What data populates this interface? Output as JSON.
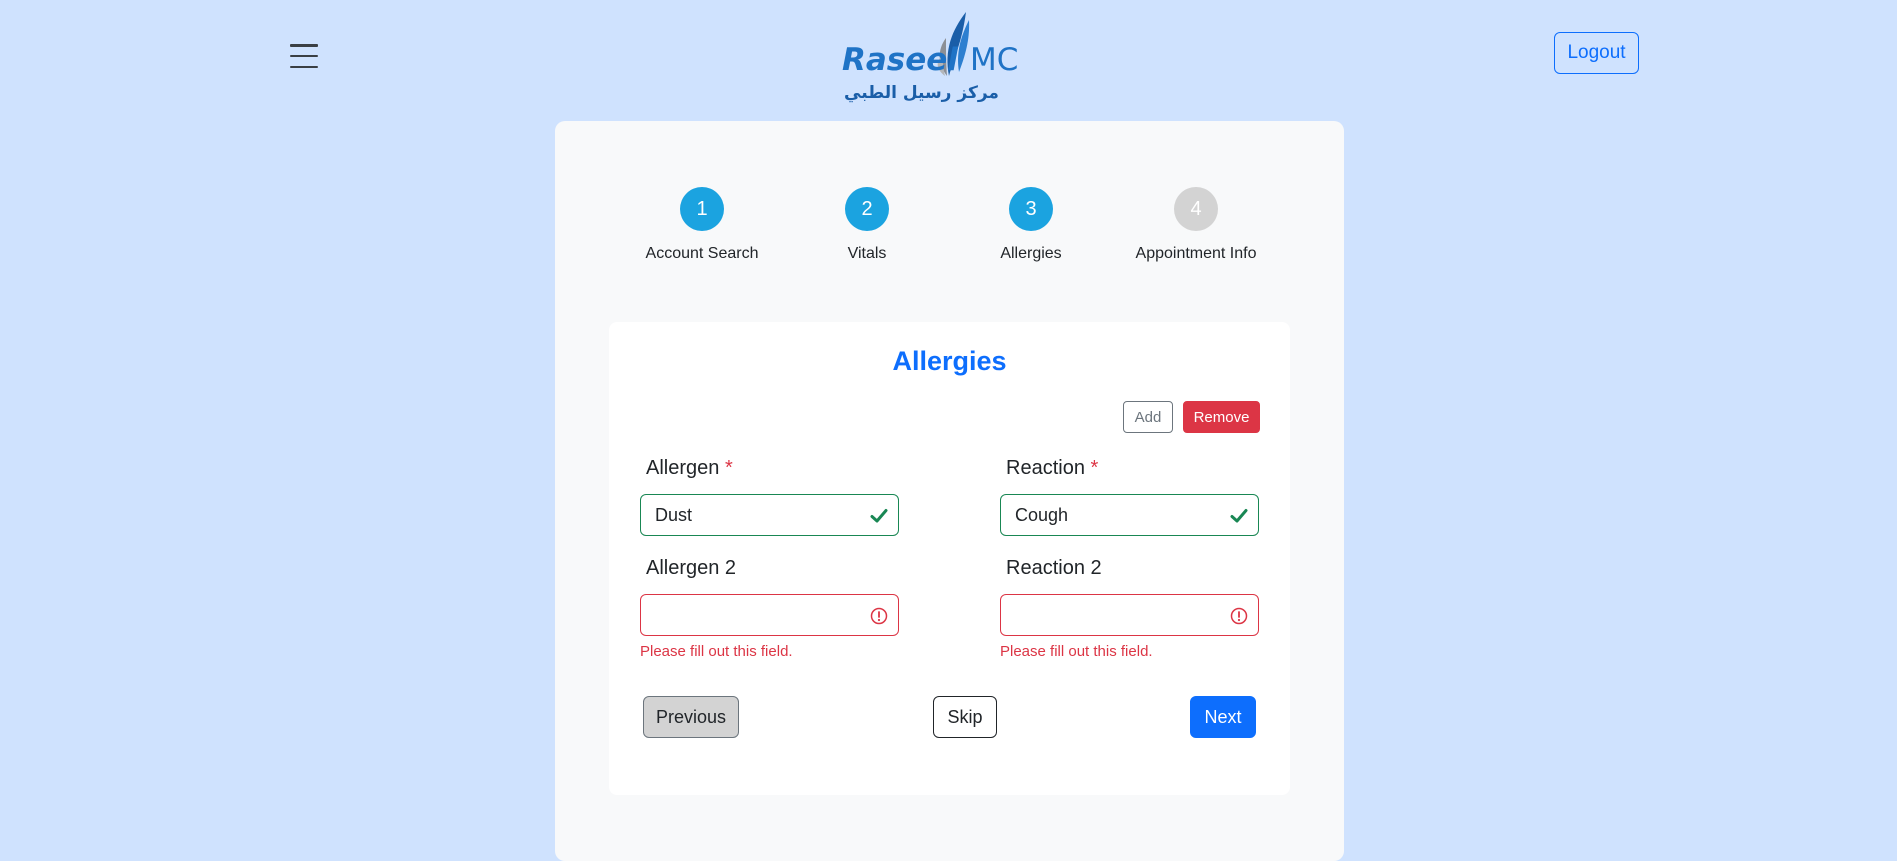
{
  "header": {
    "menu_icon": "hamburger-menu-icon",
    "logo": {
      "brand_text_1": "Raseel",
      "brand_text_2": "MC",
      "arabic_text": "مركز رسيل الطبي"
    },
    "logout_label": "Logout"
  },
  "stepper": {
    "steps": [
      {
        "number": "1",
        "label": "Account Search",
        "state": "active"
      },
      {
        "number": "2",
        "label": "Vitals",
        "state": "active"
      },
      {
        "number": "3",
        "label": "Allergies",
        "state": "active"
      },
      {
        "number": "4",
        "label": "Appointment Info",
        "state": "inactive"
      }
    ]
  },
  "form": {
    "title": "Allergies",
    "add_label": "Add",
    "remove_label": "Remove",
    "required_marker": "*",
    "fields": {
      "allergen1": {
        "label": "Allergen",
        "value": "Dust",
        "status": "valid"
      },
      "reaction1": {
        "label": "Reaction",
        "value": "Cough",
        "status": "valid"
      },
      "allergen2": {
        "label": "Allergen 2",
        "value": "",
        "status": "invalid",
        "feedback": "Please fill out this field."
      },
      "reaction2": {
        "label": "Reaction 2",
        "value": "",
        "status": "invalid",
        "feedback": "Please fill out this field."
      }
    },
    "buttons": {
      "previous": "Previous",
      "skip": "Skip",
      "next": "Next"
    }
  },
  "colors": {
    "page_background": "#cfe2fe",
    "primary": "#0d6efd",
    "step_active": "#1ba3e0",
    "step_inactive": "#d3d3d3",
    "danger": "#dc3545",
    "success": "#198754"
  }
}
